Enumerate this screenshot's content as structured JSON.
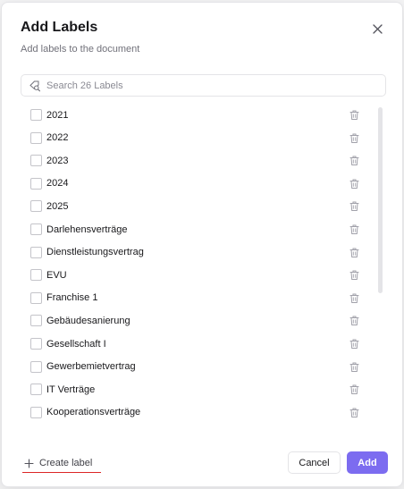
{
  "dialog": {
    "title": "Add Labels",
    "subtitle": "Add labels to the document",
    "close_icon": "close-icon"
  },
  "search": {
    "placeholder": "Search 26 Labels",
    "value": "",
    "icon": "tag-search-icon"
  },
  "labels": [
    {
      "name": "2021",
      "checked": false
    },
    {
      "name": "2022",
      "checked": false
    },
    {
      "name": "2023",
      "checked": false
    },
    {
      "name": "2024",
      "checked": false
    },
    {
      "name": "2025",
      "checked": false
    },
    {
      "name": "Darlehensverträge",
      "checked": false
    },
    {
      "name": "Dienstleistungsvertrag",
      "checked": false
    },
    {
      "name": "EVU",
      "checked": false
    },
    {
      "name": "Franchise 1",
      "checked": false
    },
    {
      "name": "Gebäudesanierung",
      "checked": false
    },
    {
      "name": "Gesellschaft I",
      "checked": false
    },
    {
      "name": "Gewerbemietvertrag",
      "checked": false
    },
    {
      "name": "IT Verträge",
      "checked": false
    },
    {
      "name": "Kooperationsverträge",
      "checked": false
    }
  ],
  "footer": {
    "create_label": "Create label",
    "cancel_label": "Cancel",
    "add_label": "Add"
  },
  "colors": {
    "accent": "#7c6cf0",
    "underline": "#dc2626",
    "text": "#18181b",
    "muted": "#71717a"
  }
}
